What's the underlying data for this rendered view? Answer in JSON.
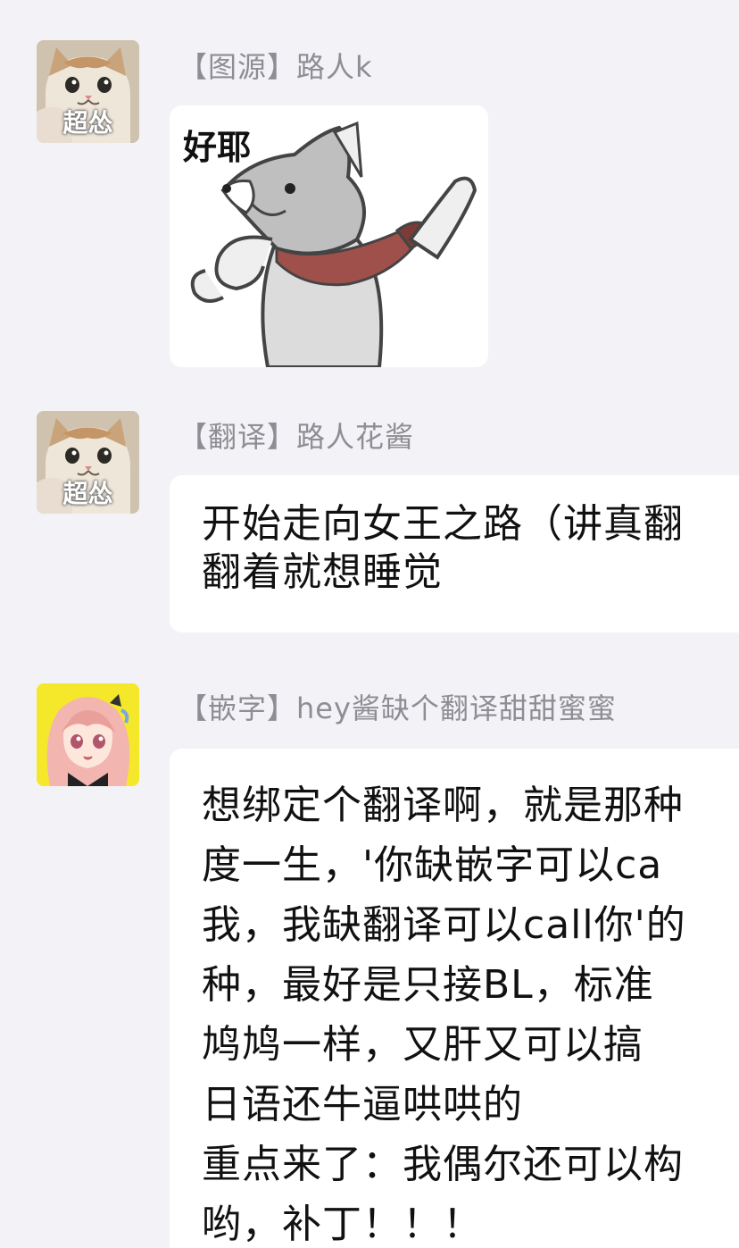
{
  "messages": [
    {
      "avatar": {
        "icon": "cat-meme-avatar-icon",
        "label": "超怂"
      },
      "sender": "【图源】路人k",
      "sticker": {
        "icon": "happy-shiba-dog-sticker-icon",
        "caption": "好耶"
      }
    },
    {
      "avatar": {
        "icon": "cat-meme-avatar-icon",
        "label": "超怂"
      },
      "sender": "【翻译】路人花酱",
      "text": "开始走向女王之路（讲真翻\n翻着就想睡觉"
    },
    {
      "avatar": {
        "icon": "anime-girl-avatar-icon"
      },
      "sender": "【嵌字】hey酱缺个翻译甜甜蜜蜜",
      "text": "想绑定个翻译啊，就是那种\n度一生，'你缺嵌字可以ca\n我，我缺翻译可以call你'的\n种，最好是只接BL，标准\n鸠鸠一样，又肝又可以搞\n日语还牛逼哄哄的\n重点来了：我偶尔还可以构\n哟，补丁！！！"
    }
  ],
  "colors": {
    "background": "#f3f3f7",
    "bubble": "#ffffff",
    "sender_name": "#8d8d93",
    "message_text": "#111111",
    "avatar_anime_bg": "#f5e82a"
  }
}
